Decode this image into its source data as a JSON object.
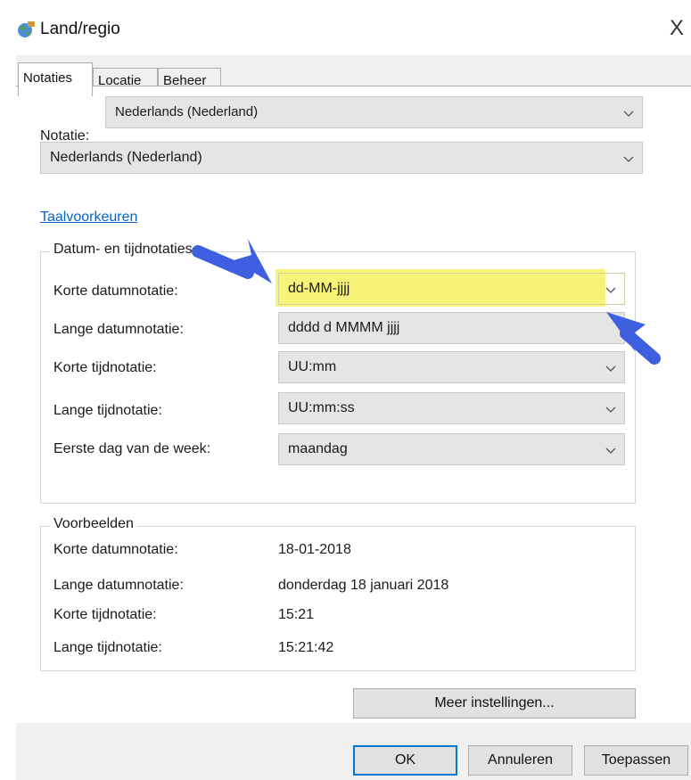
{
  "window": {
    "title": "Land/regio",
    "close_label": "X"
  },
  "tabs": [
    {
      "label": "Notaties"
    },
    {
      "label": "Locatie"
    },
    {
      "label": "Beheer"
    }
  ],
  "notatie": {
    "label": "Notatie:",
    "top_value": "Nederlands (Nederland)",
    "value": "Nederlands (Nederland)"
  },
  "link": {
    "label": "Taalvoorkeuren"
  },
  "formats": {
    "legend": "Datum- en tijdnotaties",
    "rows": [
      {
        "label": "Korte datumnotatie:",
        "value": "dd-MM-jjjj"
      },
      {
        "label": "Lange datumnotatie:",
        "value": "dddd d MMMM jjjj"
      },
      {
        "label": "Korte tijdnotatie:",
        "value": "UU:mm"
      },
      {
        "label": "Lange tijdnotatie:",
        "value": "UU:mm:ss"
      },
      {
        "label": "Eerste dag van de week:",
        "value": "maandag"
      }
    ]
  },
  "examples": {
    "legend": "Voorbeelden",
    "rows": [
      {
        "label": "Korte datumnotatie:",
        "value": "18-01-2018"
      },
      {
        "label": "Lange datumnotatie:",
        "value": "donderdag 18 januari 2018"
      },
      {
        "label": "Korte tijdnotatie:",
        "value": "15:21"
      },
      {
        "label": "Lange tijdnotatie:",
        "value": "15:21:42"
      }
    ]
  },
  "buttons": {
    "more": "Meer instellingen...",
    "ok": "OK",
    "cancel": "Annuleren",
    "apply": "Toepassen"
  },
  "colors": {
    "highlight": "#f6f26a",
    "arrow": "#3d5fe0",
    "link": "#0066cc"
  }
}
